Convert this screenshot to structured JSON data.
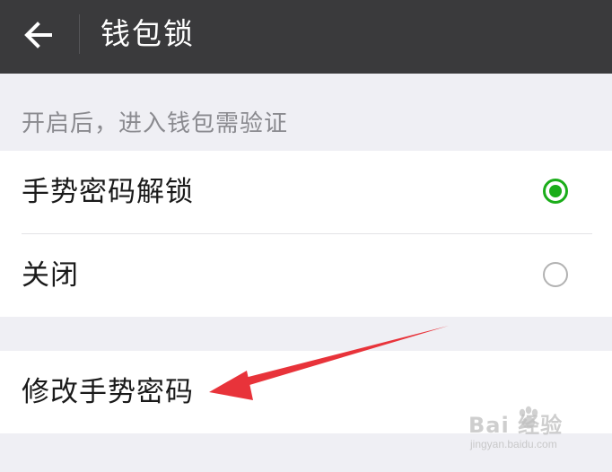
{
  "header": {
    "back_icon": "arrow-left-icon",
    "title": "钱包锁"
  },
  "wallet_lock": {
    "caption": "开启后，进入钱包需验证",
    "options": [
      {
        "label": "手势密码解锁",
        "selected": true
      },
      {
        "label": "关闭",
        "selected": false
      }
    ],
    "modify_label": "修改手势密码"
  },
  "watermark": {
    "main": "Bai 经验",
    "sub": "jingyan.baidu.com"
  },
  "colors": {
    "header_bg": "#3a3a3c",
    "page_bg": "#efeff4",
    "accent_green": "#1aad19",
    "annotation_red": "#e8333a"
  }
}
